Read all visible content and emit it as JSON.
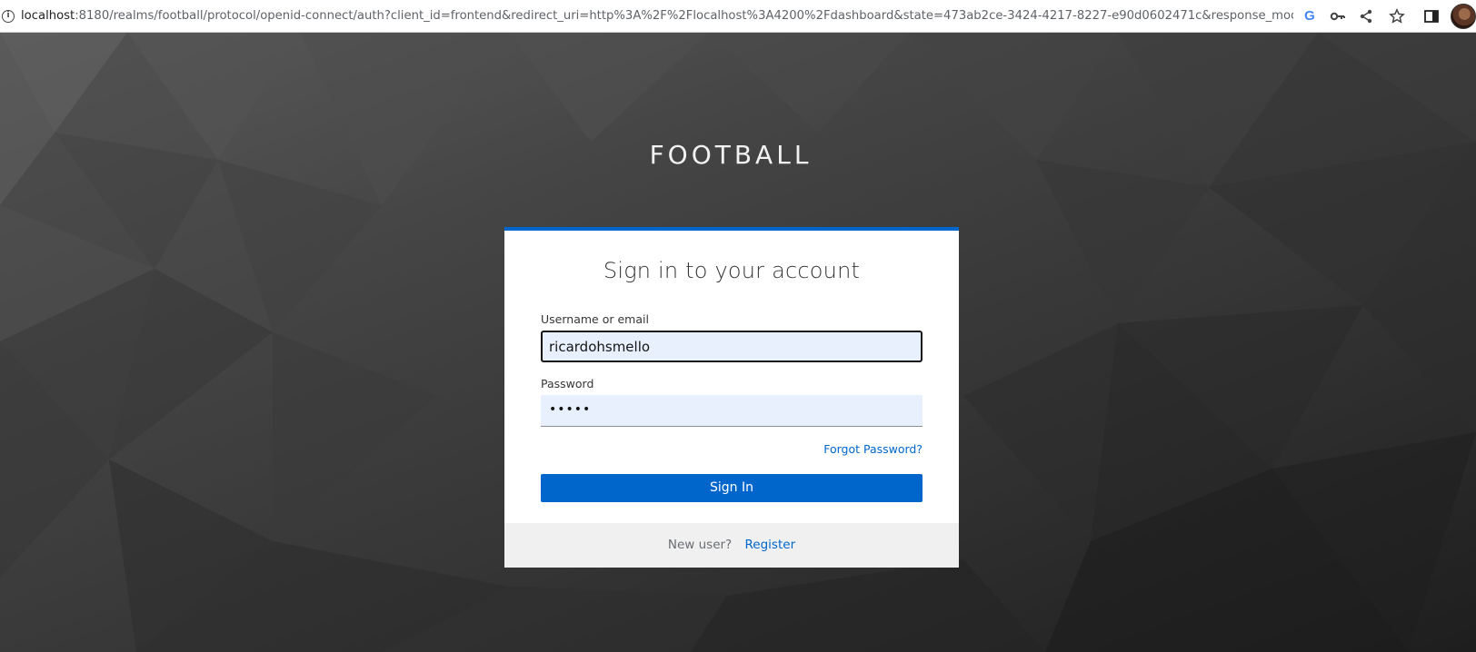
{
  "browser": {
    "url_host": "localhost",
    "url_rest": ":8180/realms/football/protocol/openid-connect/auth?client_id=frontend&redirect_uri=http%3A%2F%2Flocalhost%3A4200%2Fdashboard&state=473ab2ce-3424-4217-8227-e90d0602471c&response_mode=fra...",
    "icons": [
      "info-icon",
      "google-icon",
      "key-icon",
      "share-icon",
      "star-icon",
      "side-panel-icon",
      "profile-avatar"
    ]
  },
  "realm": {
    "title": "FOOTBALL"
  },
  "login": {
    "heading": "Sign in to your account",
    "username_label": "Username or email",
    "username_value": "ricardohsmello",
    "password_label": "Password",
    "password_value": "•••••",
    "forgot_password": "Forgot Password?",
    "sign_in_button": "Sign In",
    "new_user_text": "New user?",
    "register_link": "Register"
  },
  "colors": {
    "accent": "#0066cc",
    "card_top_border": "#0066cc",
    "autofill_bg": "#e8f0fe",
    "footer_bg": "#f0f0f0"
  }
}
